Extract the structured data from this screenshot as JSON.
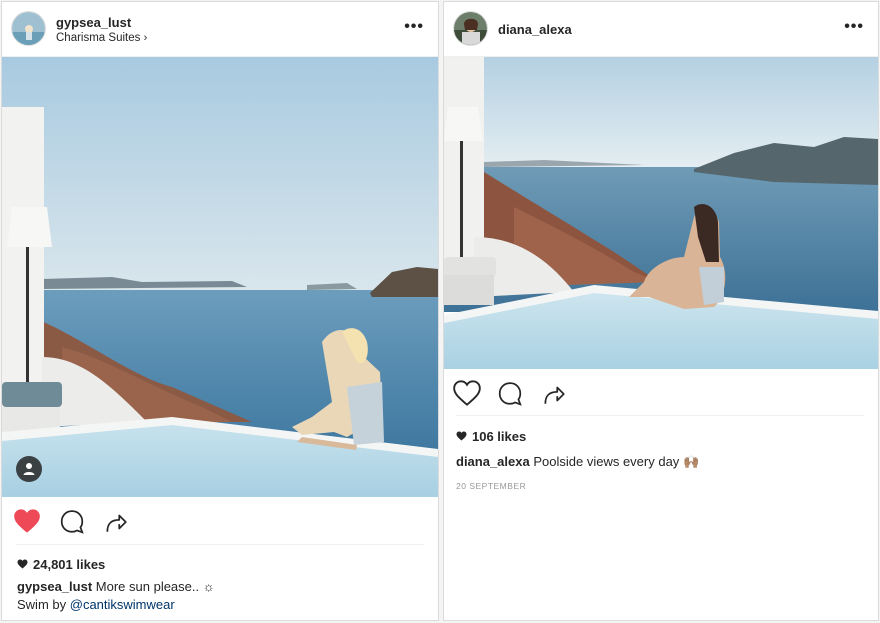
{
  "posts": [
    {
      "username": "gypsea_lust",
      "location": "Charisma Suites",
      "likes": "24,801 likes",
      "liked": true,
      "caption_user": "gypsea_lust",
      "caption_text": "More sun please.. ☼",
      "caption_line2_prefix": "Swim by",
      "caption_mention": "@cantikswimwear"
    },
    {
      "username": "diana_alexa",
      "likes": "106 likes",
      "liked": false,
      "caption_user": "diana_alexa",
      "caption_text": "Poolside views every day",
      "caption_emoji": "🙌🏽",
      "date": "20 SEPTEMBER"
    }
  ],
  "icons": [
    "more-icon",
    "heart-icon",
    "comment-icon",
    "share-icon",
    "user-tag-icon",
    "small-heart-icon",
    "chevron-right-icon"
  ],
  "colors": {
    "liked_heart": "#ed4956",
    "text": "#262626",
    "muted": "#999999",
    "mention": "#003569"
  }
}
